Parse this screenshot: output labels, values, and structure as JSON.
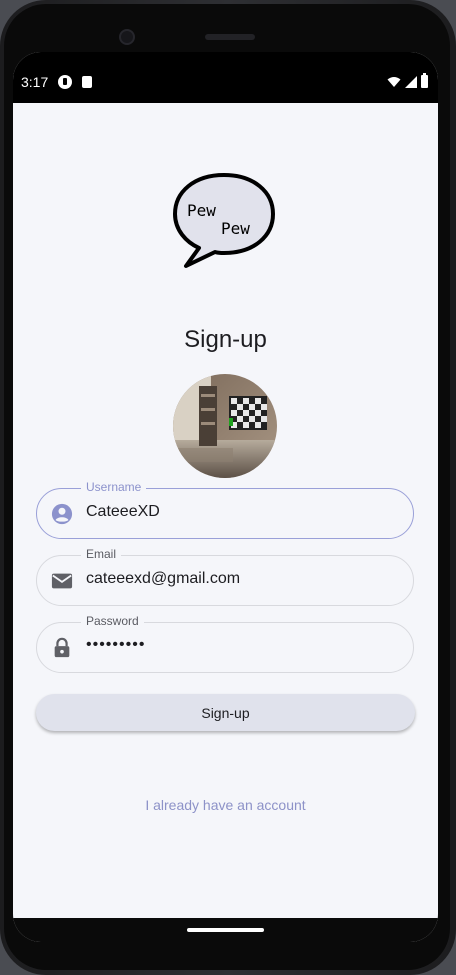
{
  "status_bar": {
    "time": "3:17"
  },
  "logo": {
    "line1": "Pew",
    "line2": "Pew"
  },
  "page": {
    "title": "Sign-up"
  },
  "form": {
    "username": {
      "label": "Username",
      "value": "CateeeXD",
      "icon": "account-circle-icon"
    },
    "email": {
      "label": "Email",
      "value": "cateeexd@gmail.com",
      "icon": "mail-icon"
    },
    "password": {
      "label": "Password",
      "value": "•••••••••",
      "icon": "lock-icon"
    }
  },
  "actions": {
    "signup_label": "Sign-up",
    "login_link": "I already have an account"
  },
  "colors": {
    "accent": "#8c92cc",
    "background": "#f5f6fa",
    "button": "#e0e2ec",
    "link": "#8d92c8"
  }
}
